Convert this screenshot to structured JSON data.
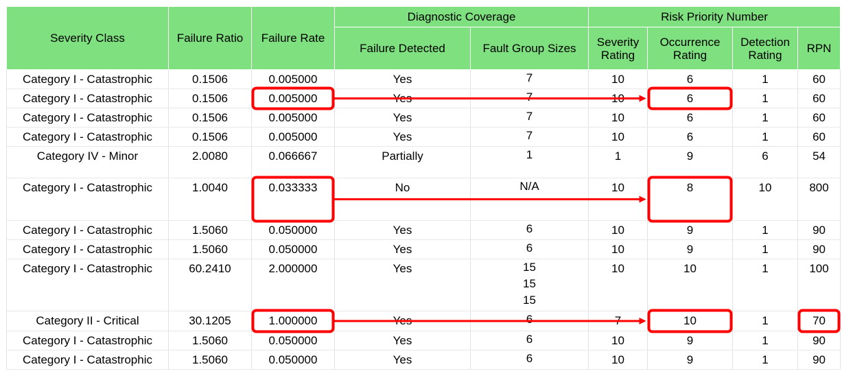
{
  "headers": {
    "severity_class": "Severity Class",
    "failure_ratio": "Failure Ratio",
    "failure_rate": "Failure Rate",
    "diagnostic_coverage": "Diagnostic Coverage",
    "failure_detected": "Failure Detected",
    "fault_group_sizes": "Fault Group Sizes",
    "risk_priority_number": "Risk Priority Number",
    "severity_rating": "Severity Rating",
    "occurrence_rating": "Occurrence Rating",
    "detection_rating": "Detection Rating",
    "rpn": "RPN"
  },
  "rows": [
    {
      "severity_class": "Category I - Catastrophic",
      "failure_ratio": "0.1506",
      "failure_rate": "0.005000",
      "failure_detected": "Yes",
      "fault_group_sizes": [
        "7"
      ],
      "severity_rating": "10",
      "occurrence_rating": "6",
      "detection_rating": "1",
      "rpn": "60"
    },
    {
      "severity_class": "Category I - Catastrophic",
      "failure_ratio": "0.1506",
      "failure_rate": "0.005000",
      "failure_detected": "Yes",
      "fault_group_sizes": [
        "7"
      ],
      "severity_rating": "10",
      "occurrence_rating": "6",
      "detection_rating": "1",
      "rpn": "60"
    },
    {
      "severity_class": "Category I - Catastrophic",
      "failure_ratio": "0.1506",
      "failure_rate": "0.005000",
      "failure_detected": "Yes",
      "fault_group_sizes": [
        "7"
      ],
      "severity_rating": "10",
      "occurrence_rating": "6",
      "detection_rating": "1",
      "rpn": "60"
    },
    {
      "severity_class": "Category I - Catastrophic",
      "failure_ratio": "0.1506",
      "failure_rate": "0.005000",
      "failure_detected": "Yes",
      "fault_group_sizes": [
        "7"
      ],
      "severity_rating": "10",
      "occurrence_rating": "6",
      "detection_rating": "1",
      "rpn": "60"
    },
    {
      "severity_class": "Category IV - Minor",
      "failure_ratio": "2.0080",
      "failure_rate": "0.066667",
      "failure_detected": "Partially",
      "fault_group_sizes": [
        "1"
      ],
      "severity_rating": "1",
      "occurrence_rating": "9",
      "detection_rating": "6",
      "rpn": "54"
    },
    {
      "severity_class": "Category I - Catastrophic",
      "failure_ratio": "1.0040",
      "failure_rate": "0.033333",
      "failure_detected": "No",
      "fault_group_sizes": [
        "N/A"
      ],
      "severity_rating": "10",
      "occurrence_rating": "8",
      "detection_rating": "10",
      "rpn": "800"
    },
    {
      "severity_class": "Category I - Catastrophic",
      "failure_ratio": "1.5060",
      "failure_rate": "0.050000",
      "failure_detected": "Yes",
      "fault_group_sizes": [
        "6"
      ],
      "severity_rating": "10",
      "occurrence_rating": "9",
      "detection_rating": "1",
      "rpn": "90"
    },
    {
      "severity_class": "Category I - Catastrophic",
      "failure_ratio": "1.5060",
      "failure_rate": "0.050000",
      "failure_detected": "Yes",
      "fault_group_sizes": [
        "6"
      ],
      "severity_rating": "10",
      "occurrence_rating": "9",
      "detection_rating": "1",
      "rpn": "90"
    },
    {
      "severity_class": "Category I - Catastrophic",
      "failure_ratio": "60.2410",
      "failure_rate": "2.000000",
      "failure_detected": "Yes",
      "fault_group_sizes": [
        "15",
        "15",
        "15"
      ],
      "severity_rating": "10",
      "occurrence_rating": "10",
      "detection_rating": "1",
      "rpn": "100"
    },
    {
      "severity_class": "Category II - Critical",
      "failure_ratio": "30.1205",
      "failure_rate": "1.000000",
      "failure_detected": "Yes",
      "fault_group_sizes": [
        "6"
      ],
      "severity_rating": "7",
      "occurrence_rating": "10",
      "detection_rating": "1",
      "rpn": "70"
    },
    {
      "severity_class": "Category I - Catastrophic",
      "failure_ratio": "1.5060",
      "failure_rate": "0.050000",
      "failure_detected": "Yes",
      "fault_group_sizes": [
        "6"
      ],
      "severity_rating": "10",
      "occurrence_rating": "9",
      "detection_rating": "1",
      "rpn": "90"
    },
    {
      "severity_class": "Category I - Catastrophic",
      "failure_ratio": "1.5060",
      "failure_rate": "0.050000",
      "failure_detected": "Yes",
      "fault_group_sizes": [
        "6"
      ],
      "severity_rating": "10",
      "occurrence_rating": "9",
      "detection_rating": "1",
      "rpn": "90"
    }
  ],
  "highlighted_rows": [
    1,
    5,
    9
  ],
  "highlighted_rpn_rows": [
    9
  ],
  "colors": {
    "header_bg": "#7ee07e",
    "highlight": "#ff0000"
  }
}
